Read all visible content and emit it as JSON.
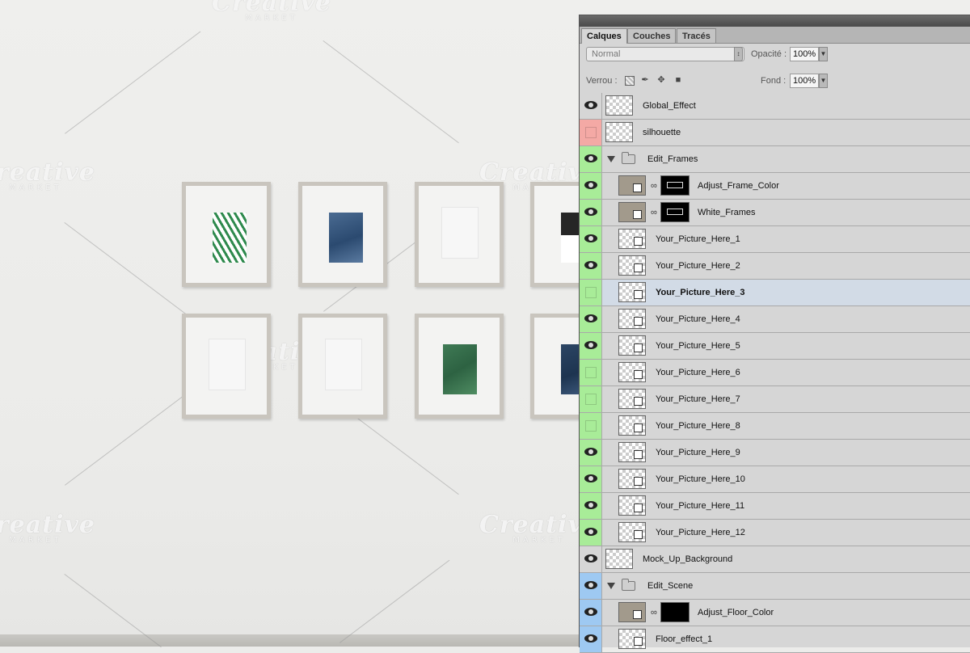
{
  "watermark": {
    "brand": "Creative",
    "sub": "MARKET"
  },
  "panel": {
    "tabs": [
      {
        "label": "Calques",
        "active": true
      },
      {
        "label": "Couches",
        "active": false
      },
      {
        "label": "Tracés",
        "active": false
      }
    ],
    "blend_mode": "Normal",
    "opacity_label": "Opacité :",
    "opacity_value": "100%",
    "lock_label": "Verrou :",
    "fill_label": "Fond :",
    "fill_value": "100%",
    "lock_icons": [
      "lock-transparent-icon",
      "lock-paint-icon",
      "lock-move-icon",
      "lock-all-icon"
    ]
  },
  "layers": [
    {
      "name": "Global_Effect",
      "kind": "layer",
      "visible": true,
      "color": "none"
    },
    {
      "name": "silhouette",
      "kind": "layer",
      "visible": false,
      "color": "#f4a9a5"
    },
    {
      "name": "Edit_Frames",
      "kind": "group",
      "visible": true,
      "color": "#a8ec98"
    },
    {
      "name": "Adjust_Frame_Color",
      "kind": "adjust",
      "visible": true,
      "color": "#a8ec98"
    },
    {
      "name": "White_Frames",
      "kind": "adjust",
      "visible": true,
      "color": "#a8ec98"
    },
    {
      "name": "Your_Picture_Here_1",
      "kind": "smart",
      "visible": true,
      "color": "#a8ec98"
    },
    {
      "name": "Your_Picture_Here_2",
      "kind": "smart",
      "visible": true,
      "color": "#a8ec98"
    },
    {
      "name": "Your_Picture_Here_3",
      "kind": "smart",
      "visible": false,
      "color": "#a8ec98",
      "selected": true
    },
    {
      "name": "Your_Picture_Here_4",
      "kind": "smart",
      "visible": true,
      "color": "#a8ec98"
    },
    {
      "name": "Your_Picture_Here_5",
      "kind": "smart",
      "visible": true,
      "color": "#a8ec98"
    },
    {
      "name": "Your_Picture_Here_6",
      "kind": "smart",
      "visible": false,
      "color": "#a8ec98"
    },
    {
      "name": "Your_Picture_Here_7",
      "kind": "smart",
      "visible": false,
      "color": "#a8ec98"
    },
    {
      "name": "Your_Picture_Here_8",
      "kind": "smart",
      "visible": false,
      "color": "#a8ec98"
    },
    {
      "name": "Your_Picture_Here_9",
      "kind": "smart",
      "visible": true,
      "color": "#a8ec98"
    },
    {
      "name": "Your_Picture_Here_10",
      "kind": "smart",
      "visible": true,
      "color": "#a8ec98"
    },
    {
      "name": "Your_Picture_Here_11",
      "kind": "smart",
      "visible": true,
      "color": "#a8ec98"
    },
    {
      "name": "Your_Picture_Here_12",
      "kind": "smart",
      "visible": true,
      "color": "#a8ec98"
    },
    {
      "name": "Mock_Up_Background",
      "kind": "layer",
      "visible": true,
      "color": "none"
    },
    {
      "name": "Edit_Scene",
      "kind": "group",
      "visible": true,
      "color": "#9ec9f2"
    },
    {
      "name": "Adjust_Floor_Color",
      "kind": "adjust",
      "visible": true,
      "color": "#9ec9f2"
    },
    {
      "name": "Floor_effect_1",
      "kind": "smart",
      "visible": true,
      "color": "#9ec9f2"
    }
  ]
}
